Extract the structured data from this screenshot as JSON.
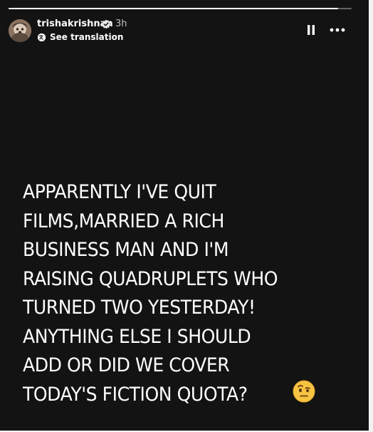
{
  "story": {
    "username": "trishakrishnan",
    "verified": true,
    "time_ago": "3h",
    "see_translation": "See translation",
    "progress": 0.96,
    "text_lines": [
      "APPARENTLY I'VE QUIT",
      "FILMS,MARRIED A RICH",
      "BUSINESS MAN AND I'M",
      "RAISING QUADRUPLETS WHO",
      "TURNED TWO YESTERDAY!",
      "ANYTHING ELSE I SHOULD",
      "ADD OR DID WE COVER",
      "TODAY'S FICTION QUOTA?"
    ],
    "emoji": "face-with-raised-eyebrow-emoji"
  },
  "controls": {
    "pause_icon": "pause-icon",
    "more_icon": "more-options-icon"
  },
  "colors": {
    "background": "#131313",
    "text": "#ffffff",
    "progress_track": "#5a5a5a",
    "progress_fill": "#ffffff",
    "verified_badge": "#0095f6"
  }
}
